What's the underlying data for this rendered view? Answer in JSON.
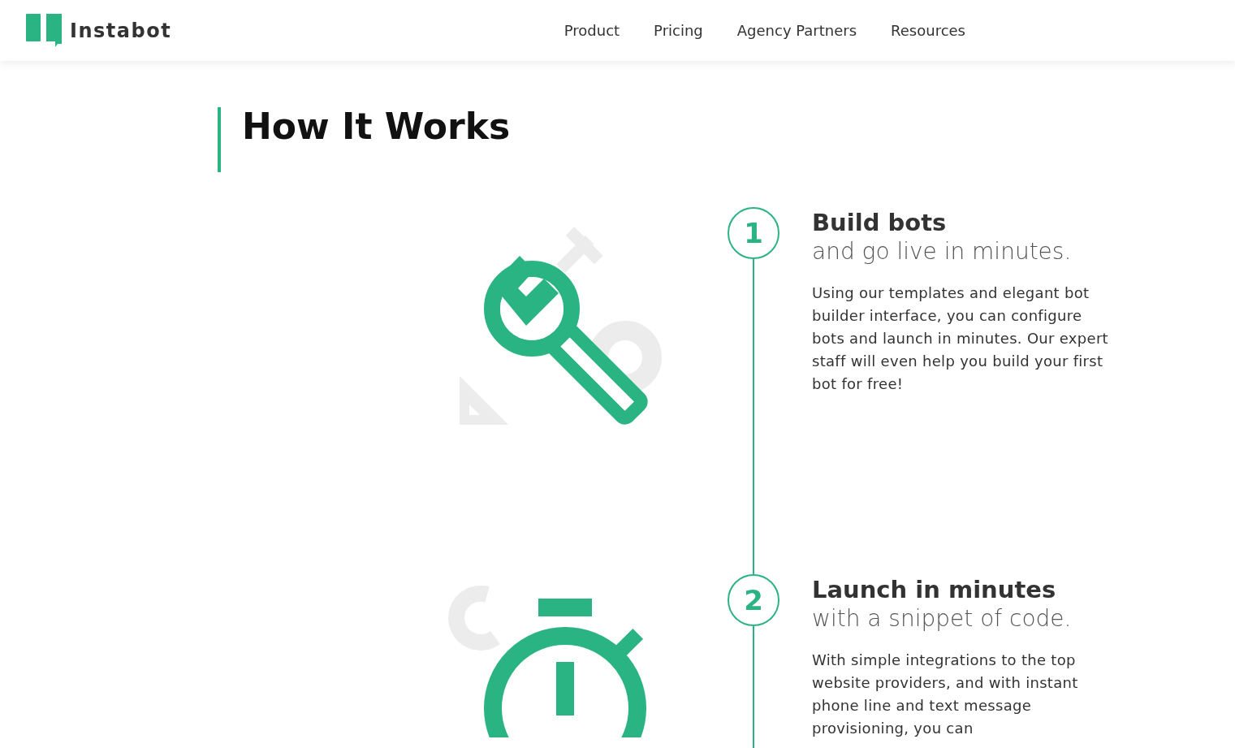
{
  "header": {
    "logo": "Instabot",
    "nav": [
      {
        "label": "Product"
      },
      {
        "label": "Pricing"
      },
      {
        "label": "Agency Partners"
      },
      {
        "label": "Resources"
      }
    ]
  },
  "section": {
    "title": "How It Works",
    "steps": [
      {
        "kind": "wrench",
        "number": "1",
        "title": "Build bots",
        "subtitle": "and go live in minutes.",
        "body": "Using our templates and elegant bot builder interface, you can configure bots and launch in minutes. Our expert staff will even help you build your first bot for free!"
      },
      {
        "kind": "stopwatch",
        "number": "2",
        "title": "Launch in minutes",
        "subtitle": "with a snippet of code.",
        "body": "With simple integrations to the top website providers, and with instant phone line and text message provisioning, you can"
      }
    ]
  }
}
